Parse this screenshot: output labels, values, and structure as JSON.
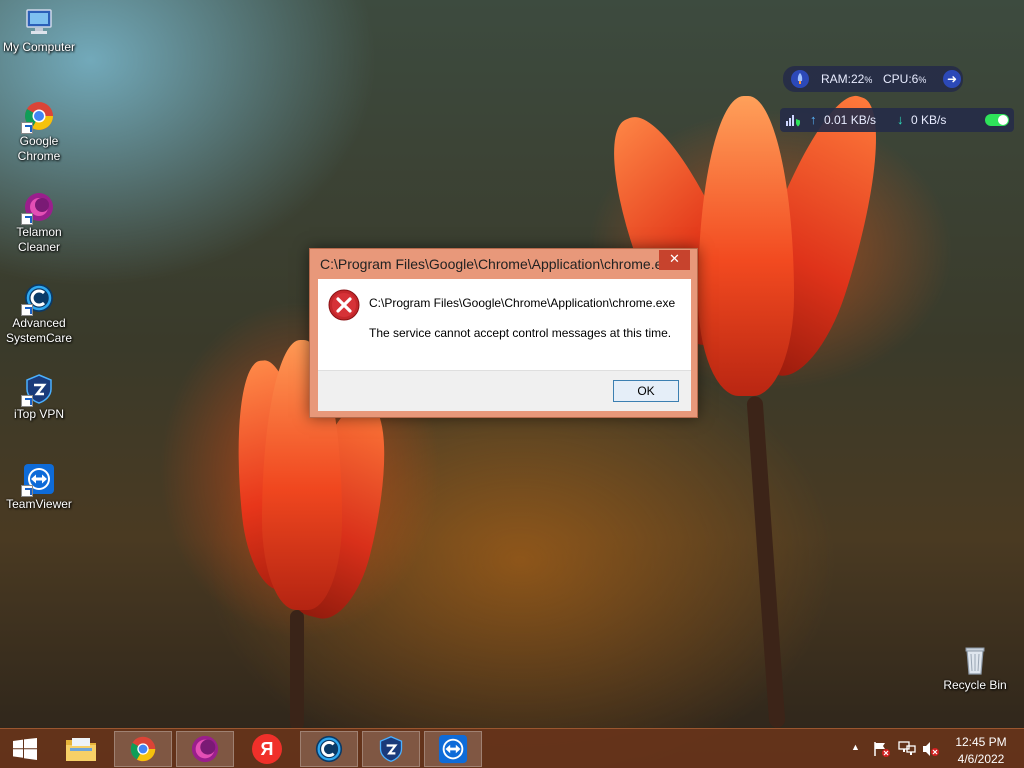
{
  "desktop": {
    "icons": [
      {
        "label_line1": "My Computer",
        "label_line2": "",
        "icon": "computer-icon"
      },
      {
        "label_line1": "Google",
        "label_line2": "Chrome",
        "icon": "chrome-icon"
      },
      {
        "label_line1": "Telamon",
        "label_line2": "Cleaner",
        "icon": "telamon-icon"
      },
      {
        "label_line1": "Advanced",
        "label_line2": "SystemCare",
        "icon": "systemcare-icon"
      },
      {
        "label_line1": "iTop VPN",
        "label_line2": "",
        "icon": "vpn-shield-icon"
      },
      {
        "label_line1": "TeamViewer",
        "label_line2": "",
        "icon": "teamviewer-icon"
      }
    ],
    "recycle_bin": {
      "label": "Recycle Bin",
      "icon": "recycle-bin-icon"
    }
  },
  "widget": {
    "ram_label": "RAM:",
    "ram_value": "22",
    "cpu_label": "CPU:",
    "cpu_value": "6",
    "percent": "%",
    "upload": "0.01 KB/s",
    "download": "0 KB/s",
    "toggle_on": true,
    "accent": "#3d6cf0",
    "toggle_color": "#2ee35a"
  },
  "dialog": {
    "title": "C:\\Program Files\\Google\\Chrome\\Application\\chrome.exe",
    "close_glyph": "✕",
    "path": "C:\\Program Files\\Google\\Chrome\\Application\\chrome.exe",
    "message": "The service cannot accept control messages at this time.",
    "ok_label": "OK",
    "icon": "error-icon"
  },
  "taskbar": {
    "apps": [
      {
        "name": "file-explorer",
        "icon": "folder-icon",
        "active": false
      },
      {
        "name": "chrome",
        "icon": "chrome-icon",
        "active": true
      },
      {
        "name": "telamon",
        "icon": "telamon-icon",
        "active": true
      },
      {
        "name": "yandex",
        "icon": "yandex-icon",
        "glyph": "Я",
        "active": false
      },
      {
        "name": "advanced-systemcare",
        "icon": "systemcare-icon",
        "active": true
      },
      {
        "name": "itop-vpn",
        "icon": "vpn-shield-icon",
        "active": true
      },
      {
        "name": "teamviewer",
        "icon": "teamviewer-icon",
        "active": true
      }
    ],
    "tray": {
      "chevron": "▲",
      "time": "12:45 PM",
      "date": "4/6/2022"
    },
    "color": "#68341a"
  }
}
